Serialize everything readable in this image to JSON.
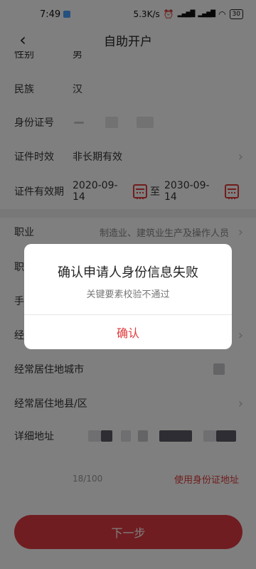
{
  "status_bar": {
    "time": "7:49",
    "net_speed": "5.3K/s",
    "battery": "30"
  },
  "header": {
    "title": "自助开户",
    "back_icon": "chevron-left-icon"
  },
  "form": {
    "gender": {
      "label": "性别",
      "value": "男"
    },
    "ethnicity": {
      "label": "民族",
      "value": "汉"
    },
    "id_number": {
      "label": "身份证号"
    },
    "validity_type": {
      "label": "证件时效",
      "value": "非长期有效"
    },
    "validity_period": {
      "label": "证件有效期",
      "start": "2020-09-14",
      "separator": "至",
      "end": "2030-09-14"
    },
    "occupation": {
      "label": "职业",
      "value": "制造业、建筑业生产及操作人员"
    },
    "row7_label": "职",
    "row8_label": "手",
    "row9_label": "经",
    "city": {
      "label": "经常居住地城市"
    },
    "district": {
      "label": "经常居住地县/区"
    },
    "address": {
      "label": "详细地址"
    },
    "address_counter": "18/100",
    "use_id_address": "使用身份证地址"
  },
  "actions": {
    "next": "下一步"
  },
  "dialog": {
    "title": "确认申请人身份信息失败",
    "message": "关键要素校验不通过",
    "confirm": "确认"
  },
  "colors": {
    "accent": "#e03a3a",
    "overlay": "rgba(0,0,0,0.5)"
  }
}
